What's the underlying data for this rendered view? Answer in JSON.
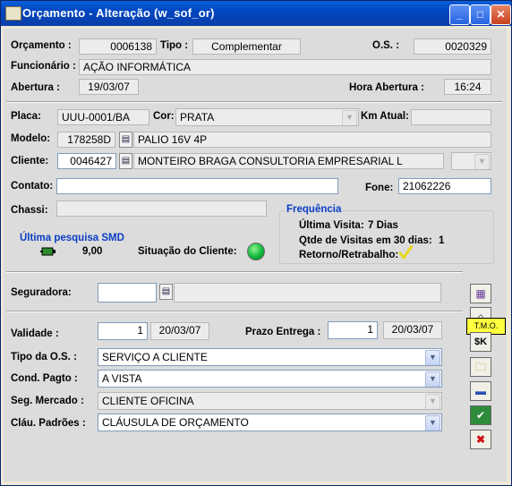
{
  "window": {
    "title": "Orçamento - Alteração (w_sof_or)"
  },
  "labels": {
    "orcamento": "Orçamento :",
    "tipo": "Tipo :",
    "os": "O.S. :",
    "funcionario": "Funcionário :",
    "abertura": "Abertura :",
    "hora_abertura": "Hora Abertura :",
    "placa": "Placa:",
    "cor": "Cor:",
    "km_atual": "Km Atual:",
    "modelo": "Modelo:",
    "cliente": "Cliente:",
    "contato": "Contato:",
    "fone": "Fone:",
    "chassi": "Chassi:",
    "seguradora": "Seguradora:",
    "validade": "Validade :",
    "prazo_entrega": "Prazo Entrega :",
    "tipo_os": "Tipo da O.S. :",
    "cond_pagto": "Cond. Pagto :",
    "seg_mercado": "Seg. Mercado :",
    "clau_padroes": "Cláu. Padrões :"
  },
  "fields": {
    "orcamento": "0006138",
    "tipo": "Complementar",
    "os": "0020329",
    "funcionario": "AÇÃO INFORMÁTICA",
    "abertura": "19/03/07",
    "hora_abertura": "16:24",
    "placa": "UUU-0001/BA",
    "cor": "PRATA",
    "km_atual": "",
    "modelo_code": "178258D",
    "modelo_desc": "PALIO 16V 4P",
    "cliente_code": "0046427",
    "cliente_name": "MONTEIRO BRAGA CONSULTORIA EMPRESARIAL L",
    "contato": "",
    "fone": "21062226",
    "chassi": "",
    "seguradora_code": "",
    "seguradora_name": "",
    "validade_days": "1",
    "validade_date": "20/03/07",
    "prazo_days": "1",
    "prazo_date": "20/03/07",
    "tipo_os": "SERVIÇO A CLIENTE",
    "cond_pagto": "A VISTA",
    "seg_mercado": "CLIENTE OFICINA",
    "clau_padroes": "CLÁUSULA DE ORÇAMENTO"
  },
  "smd": {
    "title": "Última pesquisa SMD",
    "value": "9,00"
  },
  "situacao": {
    "label": "Situação do Cliente:",
    "color": "#18c040"
  },
  "frequencia": {
    "title": "Frequência",
    "ultima_visita": "Última Visita:",
    "ultima_visita_value": "7 Dias",
    "qtde_label": "Qtde de Visitas em 30 dias:",
    "qtde_value": "1",
    "retorno_label": "Retorno/Retrabalho:"
  },
  "tooltip": "T.M.O.",
  "side_buttons": [
    {
      "icon": "print-icon"
    },
    {
      "icon": "tmo-icon"
    },
    {
      "icon": "skip-icon"
    },
    {
      "icon": "folder-icon"
    },
    {
      "icon": "truck-icon"
    },
    {
      "icon": "save-icon"
    },
    {
      "icon": "cancel-icon"
    }
  ]
}
